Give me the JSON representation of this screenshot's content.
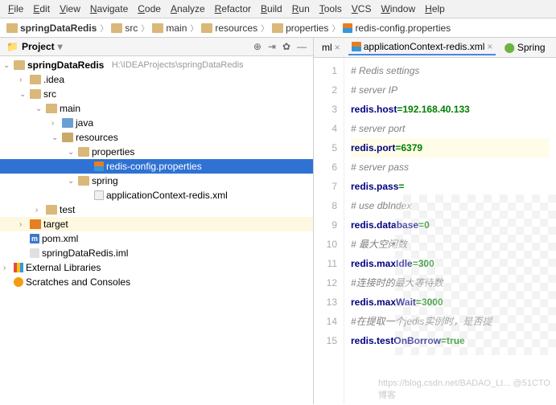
{
  "menu": [
    "File",
    "Edit",
    "View",
    "Navigate",
    "Code",
    "Analyze",
    "Refactor",
    "Build",
    "Run",
    "Tools",
    "VCS",
    "Window",
    "Help"
  ],
  "breadcrumb": [
    {
      "label": "springDataRedis",
      "bold": true
    },
    {
      "label": "src"
    },
    {
      "label": "main"
    },
    {
      "label": "resources"
    },
    {
      "label": "properties"
    },
    {
      "label": "redis-config.properties",
      "icon": "props"
    }
  ],
  "panel": {
    "title": "Project"
  },
  "tree": {
    "root": "springDataRedis",
    "rootPath": "H:\\IDEAProjects\\springDataRedis",
    "idea": ".idea",
    "src": "src",
    "main": "main",
    "java": "java",
    "resources": "resources",
    "properties": "properties",
    "selected": "redis-config.properties",
    "spring": "spring",
    "springFile": "applicationContext-redis.xml",
    "test": "test",
    "target": "target",
    "pom": "pom.xml",
    "iml": "springDataRedis.iml",
    "extlib": "External Libraries",
    "scratch": "Scratches and Consoles"
  },
  "tabs": {
    "t0": "ml",
    "t1": "applicationContext-redis.xml",
    "t2": "Spring"
  },
  "code": [
    {
      "n": 1,
      "type": "cmt",
      "text": "# Redis settings"
    },
    {
      "n": 2,
      "type": "cmt",
      "text": "# server IP"
    },
    {
      "n": 3,
      "type": "kv",
      "k": "redis.host",
      "v": "192.168.40.133"
    },
    {
      "n": 4,
      "type": "cmt",
      "text": "# server port"
    },
    {
      "n": 5,
      "type": "kv",
      "k": "redis.port",
      "v": "6379",
      "hl": true
    },
    {
      "n": 6,
      "type": "cmt",
      "text": "# server pass"
    },
    {
      "n": 7,
      "type": "kv",
      "k": "redis.pass",
      "v": ""
    },
    {
      "n": 8,
      "type": "cmt",
      "text": "# use dbIndex"
    },
    {
      "n": 9,
      "type": "kv",
      "k": "redis.database",
      "v": "0"
    },
    {
      "n": 10,
      "type": "cmt",
      "text": "# 最大空闲数"
    },
    {
      "n": 11,
      "type": "kv",
      "k": "redis.maxIdle",
      "v": "300"
    },
    {
      "n": 12,
      "type": "cmt",
      "text": "#连接时的最大等待数"
    },
    {
      "n": 13,
      "type": "kv",
      "k": "redis.maxWait",
      "v": "3000"
    },
    {
      "n": 14,
      "type": "cmt",
      "text": "#在提取一个jedis实例时，是否提"
    },
    {
      "n": 15,
      "type": "kv",
      "k": "redis.testOnBorrow",
      "v": "true"
    }
  ],
  "watermark": "https://blog.csdn.net/BADAO_LI... @51CTO博客"
}
